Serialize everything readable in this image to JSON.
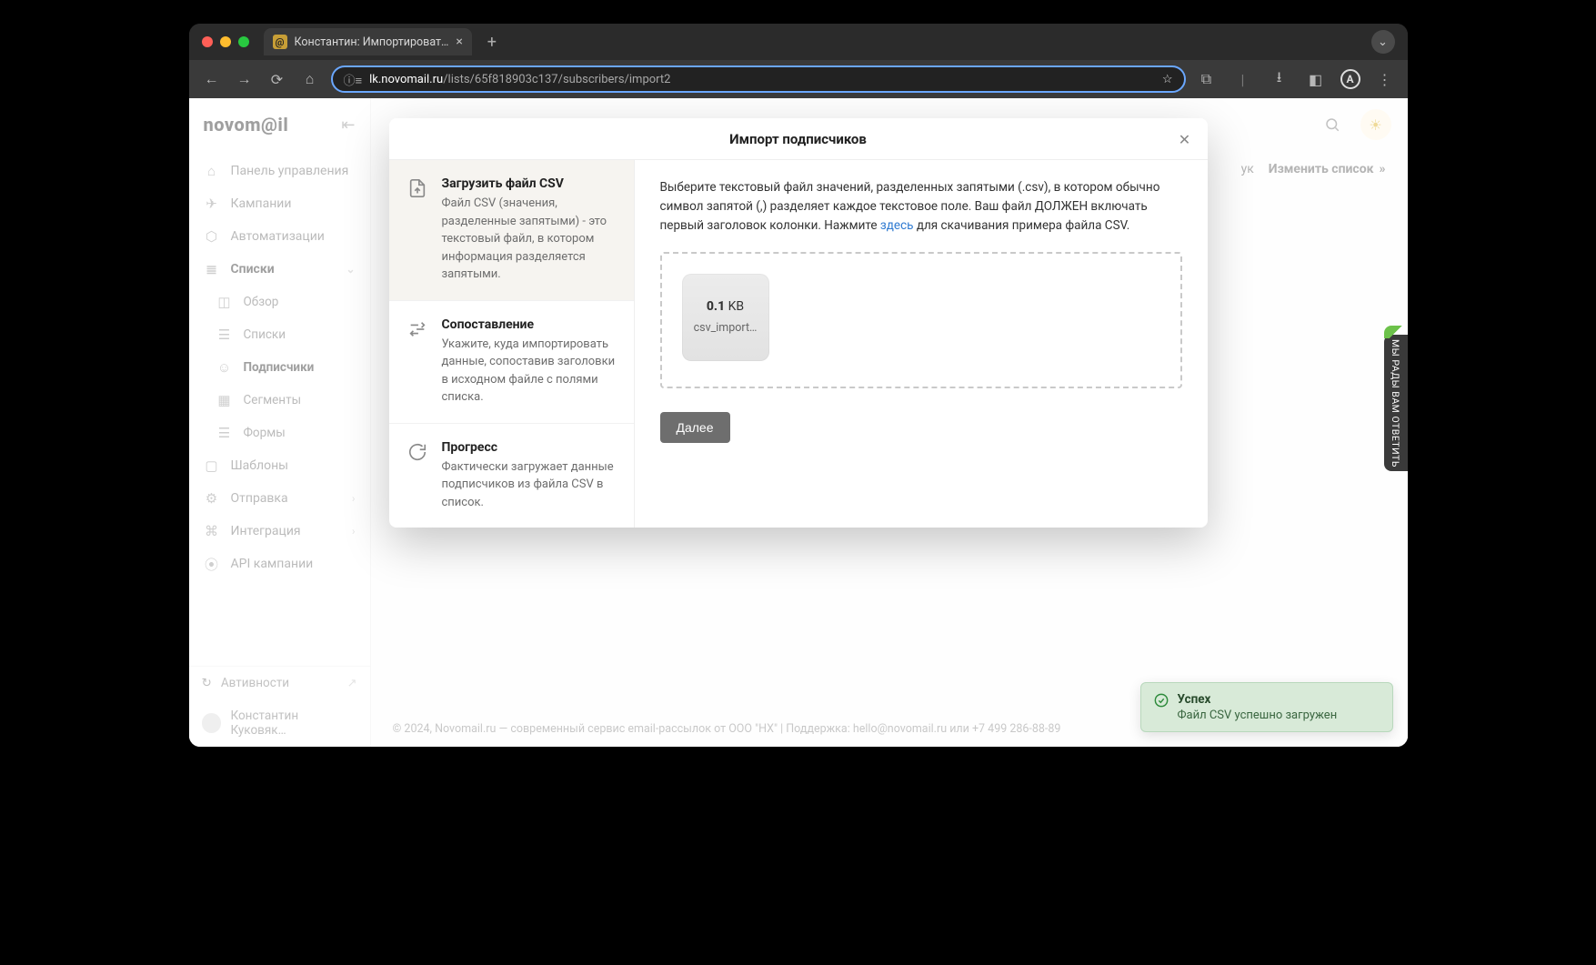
{
  "browser": {
    "tab_title": "Константин: Импортироват…",
    "url_host": "lk.novomail.ru",
    "url_path": "/lists/65f818903c137/subscribers/import2"
  },
  "sidebar": {
    "logo": "novom@il",
    "items": [
      {
        "label": "Панель управления"
      },
      {
        "label": "Кампании"
      },
      {
        "label": "Автоматизации"
      },
      {
        "label": "Списки"
      },
      {
        "label": "Обзор"
      },
      {
        "label": "Списки"
      },
      {
        "label": "Подписчики"
      },
      {
        "label": "Сегменты"
      },
      {
        "label": "Формы"
      },
      {
        "label": "Шаблоны"
      },
      {
        "label": "Отправка"
      },
      {
        "label": "Интеграция"
      },
      {
        "label": "API кампании"
      }
    ],
    "activity_label": "Автивности",
    "user_name": "Константин Куковяк…"
  },
  "header_actions": {
    "truncated_left": "ук",
    "edit_list": "Изменить список"
  },
  "modal": {
    "title": "Импорт подписчиков",
    "steps": [
      {
        "title": "Загрузить файл CSV",
        "desc": "Файл CSV (значения, разделенные запятыми) - это текстовый файл, в котором информация разделяется запятыми."
      },
      {
        "title": "Сопоставление",
        "desc": "Укажите, куда импортировать данные, сопоставив заголовки в исходном файле с полями списка."
      },
      {
        "title": "Прогресс",
        "desc": "Фактически загружает данные подписчиков из файла CSV в список."
      }
    ],
    "instruction_pre": "Выберите текстовый файл значений, разделенных запятыми (.csv), в котором обычно символ запятой (,) разделяет каждое текстовое поле. Ваш файл ДОЛЖЕН включать первый заголовок колонки. Нажмите ",
    "instruction_link": "здесь",
    "instruction_post": " для скачивания примера файла CSV.",
    "file": {
      "size_value": "0.1",
      "size_unit": "KB",
      "name": "csv_import…"
    },
    "next_button": "Далее"
  },
  "toast": {
    "title": "Успех",
    "message": "Файл CSV успешно загружен"
  },
  "feedback_tab": "МЫ РАДЫ ВАМ ОТВЕТИТЬ",
  "footer": "© 2024, Novomail.ru — современный сервис email-рассылок от ООО \"НХ\" | Поддержка: hello@novomail.ru или +7 499 286-88-89"
}
